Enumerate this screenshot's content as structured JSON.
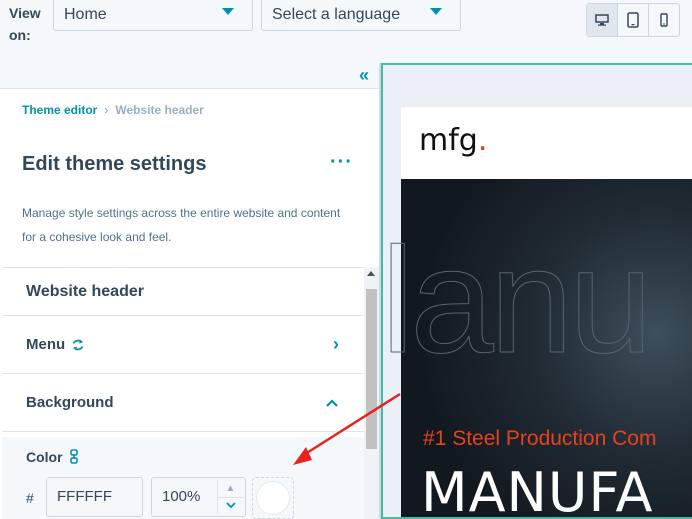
{
  "topbar": {
    "view_on_label": "View on:",
    "page_select_value": "Home",
    "language_select_placeholder": "Select a language",
    "devices": [
      "desktop",
      "tablet",
      "mobile"
    ]
  },
  "panel": {
    "collapse_icon": "double-chevron-left-icon",
    "breadcrumb": {
      "root": "Theme editor",
      "separator": "›",
      "current": "Website header"
    },
    "title": "Edit theme settings",
    "more_label": "···",
    "description": "Manage style settings across the entire website and content for a cohesive look and feel.",
    "section_header": "Website header",
    "rows": [
      {
        "label": "Menu",
        "chevron": "›"
      },
      {
        "label": "Background",
        "chevron": "^"
      }
    ],
    "color": {
      "label": "Color",
      "hash": "#",
      "hex_value": "FFFFFF",
      "opacity_value": "100%",
      "swatch_color": "#ffffff"
    }
  },
  "preview": {
    "logo_text": "mfg",
    "logo_dot": ".",
    "hero_tag": "#1 Steel Production Com",
    "hero_title": "MANUFA"
  },
  "colors": {
    "accent": "#0091ae",
    "preview_border": "#3fbf9f",
    "annotation_arrow": "#e8231e"
  }
}
